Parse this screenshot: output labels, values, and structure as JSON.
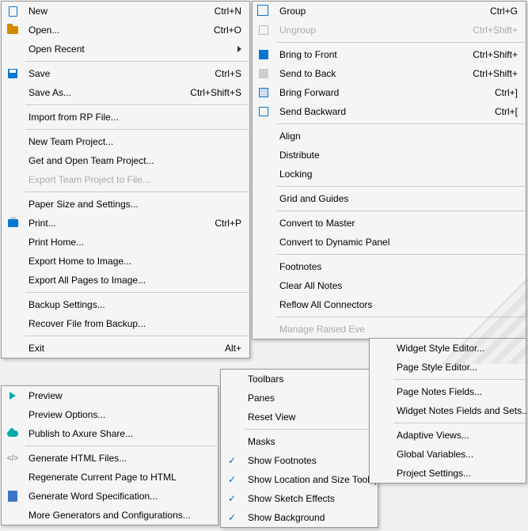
{
  "menu1": {
    "items": [
      {
        "icon": "newfile",
        "label": "New",
        "shortcut": "Ctrl+N"
      },
      {
        "icon": "openfolder",
        "label": "Open...",
        "shortcut": "Ctrl+O"
      },
      {
        "label": "Open Recent",
        "submenu": true
      },
      {
        "sep": true
      },
      {
        "icon": "save",
        "label": "Save",
        "shortcut": "Ctrl+S"
      },
      {
        "label": "Save As...",
        "shortcut": "Ctrl+Shift+S"
      },
      {
        "sep": true
      },
      {
        "label": "Import from RP File..."
      },
      {
        "sep": true
      },
      {
        "label": "New Team Project..."
      },
      {
        "label": "Get and Open Team Project..."
      },
      {
        "label": "Export Team Project to File...",
        "disabled": true
      },
      {
        "sep": true
      },
      {
        "label": "Paper Size and Settings..."
      },
      {
        "icon": "print",
        "label": "Print...",
        "shortcut": "Ctrl+P"
      },
      {
        "label": "Print Home..."
      },
      {
        "label": "Export Home to Image..."
      },
      {
        "label": "Export All Pages to Image..."
      },
      {
        "sep": true
      },
      {
        "label": "Backup Settings..."
      },
      {
        "label": "Recover File from Backup..."
      },
      {
        "sep": true
      },
      {
        "label": "Exit",
        "shortcut": "Alt+"
      }
    ]
  },
  "menu2": {
    "items": [
      {
        "icon": "play",
        "label": "Preview"
      },
      {
        "label": "Preview Options..."
      },
      {
        "icon": "cloud",
        "label": "Publish to Axure Share..."
      },
      {
        "sep": true
      },
      {
        "icon": "html",
        "label": "Generate HTML Files..."
      },
      {
        "label": "Regenerate Current Page to HTML"
      },
      {
        "icon": "word",
        "label": "Generate Word Specification..."
      },
      {
        "label": "More Generators and Configurations..."
      }
    ]
  },
  "menu3": {
    "items": [
      {
        "icon": "group",
        "label": "Group",
        "shortcut": "Ctrl+G"
      },
      {
        "icon": "ungroup",
        "label": "Ungroup",
        "shortcut": "Ctrl+Shift+",
        "disabled": true
      },
      {
        "sep": true
      },
      {
        "icon": "front",
        "label": "Bring to Front",
        "shortcut": "Ctrl+Shift+"
      },
      {
        "icon": "back",
        "label": "Send to Back",
        "shortcut": "Ctrl+Shift+"
      },
      {
        "icon": "fwd",
        "label": "Bring Forward",
        "shortcut": "Ctrl+]"
      },
      {
        "icon": "bwd",
        "label": "Send Backward",
        "shortcut": "Ctrl+["
      },
      {
        "sep": true
      },
      {
        "label": "Align"
      },
      {
        "label": "Distribute"
      },
      {
        "label": "Locking"
      },
      {
        "sep": true
      },
      {
        "label": "Grid and Guides"
      },
      {
        "sep": true
      },
      {
        "label": "Convert to Master"
      },
      {
        "label": "Convert to Dynamic Panel"
      },
      {
        "sep": true
      },
      {
        "label": "Footnotes"
      },
      {
        "label": "Clear All Notes"
      },
      {
        "label": "Reflow All Connectors"
      },
      {
        "sep": true
      },
      {
        "label": "Manage Raised Eve",
        "disabled": true
      }
    ]
  },
  "menu4": {
    "items": [
      {
        "label": "Toolbars"
      },
      {
        "label": "Panes"
      },
      {
        "label": "Reset View"
      },
      {
        "sep": true
      },
      {
        "label": "Masks"
      },
      {
        "checked": true,
        "label": "Show Footnotes"
      },
      {
        "checked": true,
        "label": "Show Location and Size Tooltip"
      },
      {
        "checked": true,
        "label": "Show Sketch Effects"
      },
      {
        "checked": true,
        "label": "Show Background"
      }
    ]
  },
  "menu5": {
    "items": [
      {
        "label": "Widget Style Editor..."
      },
      {
        "label": "Page Style Editor..."
      },
      {
        "sep": true
      },
      {
        "label": "Page Notes Fields..."
      },
      {
        "label": "Widget Notes Fields and Sets..."
      },
      {
        "sep": true
      },
      {
        "label": "Adaptive Views..."
      },
      {
        "label": "Global Variables..."
      },
      {
        "label": "Project Settings..."
      }
    ]
  }
}
